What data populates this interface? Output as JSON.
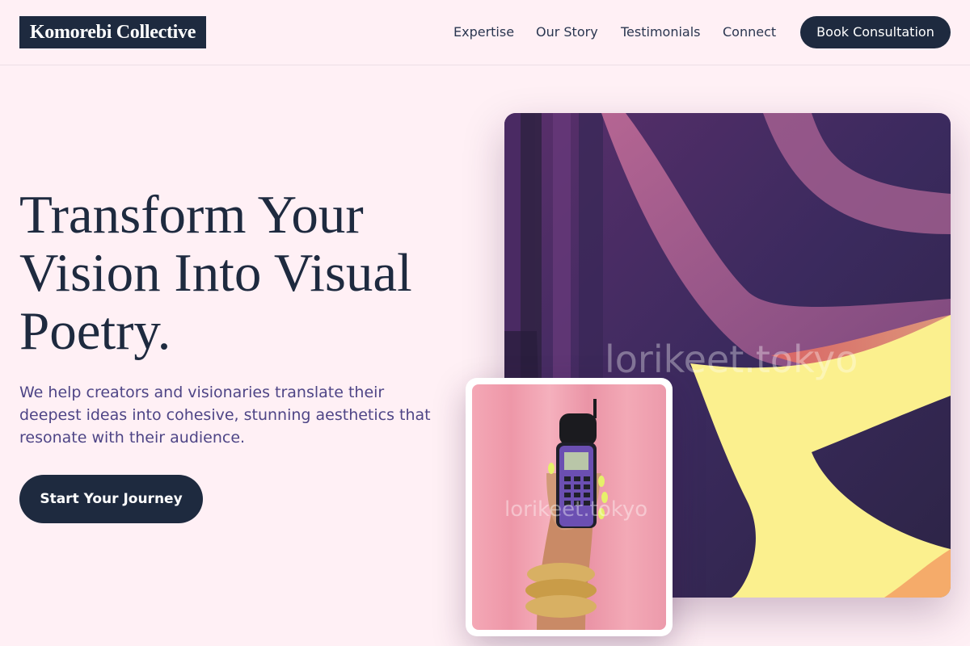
{
  "brand": {
    "name": "Komorebi Collective"
  },
  "nav": {
    "items": [
      {
        "label": "Expertise"
      },
      {
        "label": "Our Story"
      },
      {
        "label": "Testimonials"
      },
      {
        "label": "Connect"
      }
    ],
    "cta_label": "Book Consultation"
  },
  "hero": {
    "title": "Transform Your Vision Into Visual Poetry.",
    "subtitle": "We help creators and visionaries translate their deepest ideas into cohesive, stunning aesthetics that resonate with their audience.",
    "cta_label": "Start Your Journey"
  },
  "images": {
    "art_watermark": "lorikeet.tokyo",
    "photo_watermark": "lorikeet.tokyo"
  },
  "colors": {
    "background": "#fff0f5",
    "primary": "#1e2a3f",
    "subtitle": "#4e4586"
  }
}
